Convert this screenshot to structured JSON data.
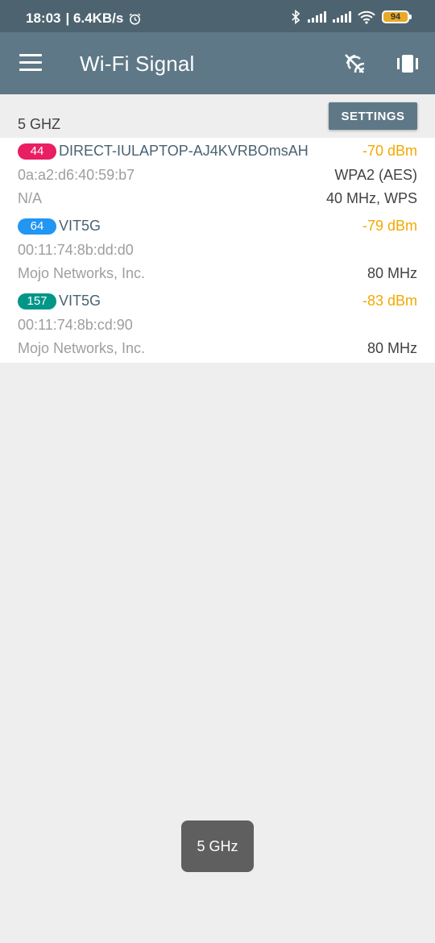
{
  "status_bar": {
    "time": "18:03",
    "speed": "| 6.4KB/s",
    "battery": "94",
    "icons": [
      "alarm-icon",
      "bluetooth-icon",
      "signal-icon",
      "signal-icon",
      "wifi-icon",
      "battery-icon"
    ]
  },
  "app_bar": {
    "title": "Wi-Fi Signal",
    "actions": [
      "signal-strength-icon",
      "vibrate-icon"
    ]
  },
  "header": {
    "band": "5 GHZ",
    "settings_label": "SETTINGS"
  },
  "networks": [
    {
      "channel": "44",
      "channel_color": "#e91e63",
      "ssid": "DIRECT-IULAPTOP-AJ4KVRBOmsAH",
      "signal": "-70 dBm",
      "mac": "0a:a2:d6:40:59:b7",
      "security": "WPA2 (AES)",
      "vendor": "N/A",
      "width": "40 MHz, WPS"
    },
    {
      "channel": "64",
      "channel_color": "#2196f3",
      "ssid": "VIT5G",
      "signal": "-79 dBm",
      "mac": "00:11:74:8b:dd:d0",
      "security": "",
      "vendor": "Mojo Networks, Inc.",
      "width": "80 MHz"
    },
    {
      "channel": "157",
      "channel_color": "#009688",
      "ssid": "VIT5G",
      "signal": "-83 dBm",
      "mac": "00:11:74:8b:cd:90",
      "security": "",
      "vendor": "Mojo Networks, Inc.",
      "width": "80 MHz"
    }
  ],
  "toast": "5 GHz",
  "colors": {
    "app_bar": "#5e7887",
    "status_bar": "#4d6470",
    "signal_text": "#f2a900"
  }
}
